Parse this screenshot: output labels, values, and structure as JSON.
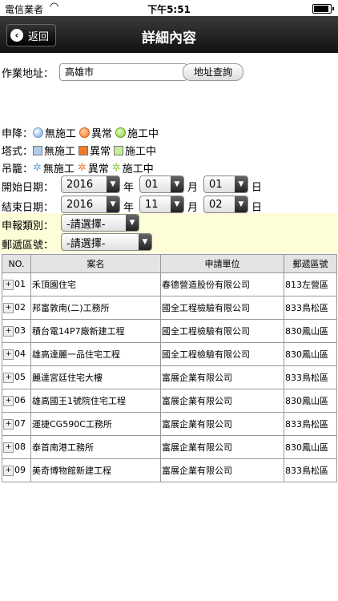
{
  "status": {
    "carrier": "電信業者",
    "time": "下午5:51",
    "battery_level": 0.95
  },
  "nav": {
    "back_label": "返回",
    "title": "詳細內容"
  },
  "address": {
    "label": "作業地址：",
    "value": "高雄市",
    "button": "地址查詢"
  },
  "filters": {
    "shenjiang": {
      "label": "申降：",
      "options": [
        "無施工",
        "異常",
        "施工中"
      ]
    },
    "tashi": {
      "label": "塔式：",
      "options": [
        "無施工",
        "異常",
        "施工中"
      ]
    },
    "diaolong": {
      "label": "吊籠：",
      "options": [
        "無施工",
        "異常",
        "施工中"
      ]
    }
  },
  "start_date": {
    "label": "開始日期：",
    "year": "2016",
    "year_unit": "年",
    "month": "01",
    "month_unit": "月",
    "day": "01",
    "day_unit": "日"
  },
  "end_date": {
    "label": "結束日期：",
    "year": "2016",
    "year_unit": "年",
    "month": "11",
    "month_unit": "月",
    "day": "02",
    "day_unit": "日"
  },
  "report_type": {
    "label": "申報類別：",
    "value": "-請選擇-"
  },
  "postal": {
    "label": "郵遞區號：",
    "value": "-請選擇-"
  },
  "table": {
    "headers": [
      "NO.",
      "案名",
      "申請單位",
      "郵遞區號"
    ],
    "rows": [
      {
        "no": "01",
        "name": "禾頂園住宅",
        "unit": "春德營造股份有限公司",
        "zip": "813左營區"
      },
      {
        "no": "02",
        "name": "邦富敦南(二)工務所",
        "unit": "國全工程檢驗有限公司",
        "zip": "833鳥松區"
      },
      {
        "no": "03",
        "name": "積台電14P7廠新建工程",
        "unit": "國全工程檢驗有限公司",
        "zip": "830鳳山區"
      },
      {
        "no": "04",
        "name": "雄高達麗一品住宅工程",
        "unit": "國全工程檢驗有限公司",
        "zip": "830鳳山區"
      },
      {
        "no": "05",
        "name": "麗達宮廷住宅大樓",
        "unit": "富展企業有限公司",
        "zip": "833鳥松區"
      },
      {
        "no": "06",
        "name": "雄高國王1號院住宅工程",
        "unit": "富展企業有限公司",
        "zip": "830鳳山區"
      },
      {
        "no": "07",
        "name": "運捷CG590C工務所",
        "unit": "富展企業有限公司",
        "zip": "833鳥松區"
      },
      {
        "no": "08",
        "name": "泰首南港工務所",
        "unit": "富展企業有限公司",
        "zip": "830鳳山區"
      },
      {
        "no": "09",
        "name": "美奇博物館新建工程",
        "unit": "富展企業有限公司",
        "zip": "833鳥松區"
      }
    ]
  },
  "colors": {
    "normal": "#6aa0d8",
    "abnormal": "#f07b2a",
    "working": "#8ccc3c"
  }
}
